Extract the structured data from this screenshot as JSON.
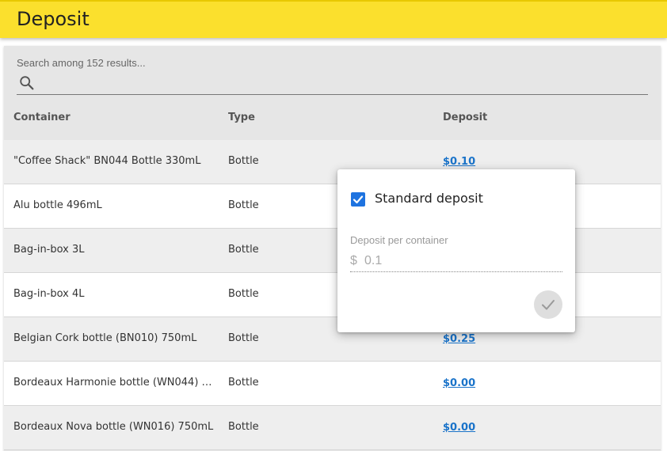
{
  "header": {
    "title": "Deposit"
  },
  "search": {
    "label": "Search among 152 results...",
    "value": ""
  },
  "table": {
    "headers": {
      "container": "Container",
      "type": "Type",
      "deposit": "Deposit"
    },
    "rows": [
      {
        "container": "\"Coffee Shack\" BN044 Bottle 330mL",
        "type": "Bottle",
        "deposit": "$0.10"
      },
      {
        "container": "Alu bottle 496mL",
        "type": "Bottle",
        "deposit": ""
      },
      {
        "container": "Bag-in-box 3L",
        "type": "Bottle",
        "deposit": ""
      },
      {
        "container": "Bag-in-box 4L",
        "type": "Bottle",
        "deposit": ""
      },
      {
        "container": "Belgian Cork bottle (BN010) 750mL",
        "type": "Bottle",
        "deposit": "$0.25"
      },
      {
        "container": "Bordeaux Harmonie bottle (WN044) 5...",
        "type": "Bottle",
        "deposit": "$0.00"
      },
      {
        "container": "Bordeaux Nova bottle (WN016) 750mL",
        "type": "Bottle",
        "deposit": "$0.00"
      }
    ]
  },
  "popup": {
    "checkbox_label": "Standard deposit",
    "checkbox_checked": true,
    "field_label": "Deposit per container",
    "currency": "$",
    "value": "0.1"
  },
  "colors": {
    "topbar": "#fbe02d",
    "link": "#1a73c9",
    "checkbox": "#1e73e0"
  }
}
